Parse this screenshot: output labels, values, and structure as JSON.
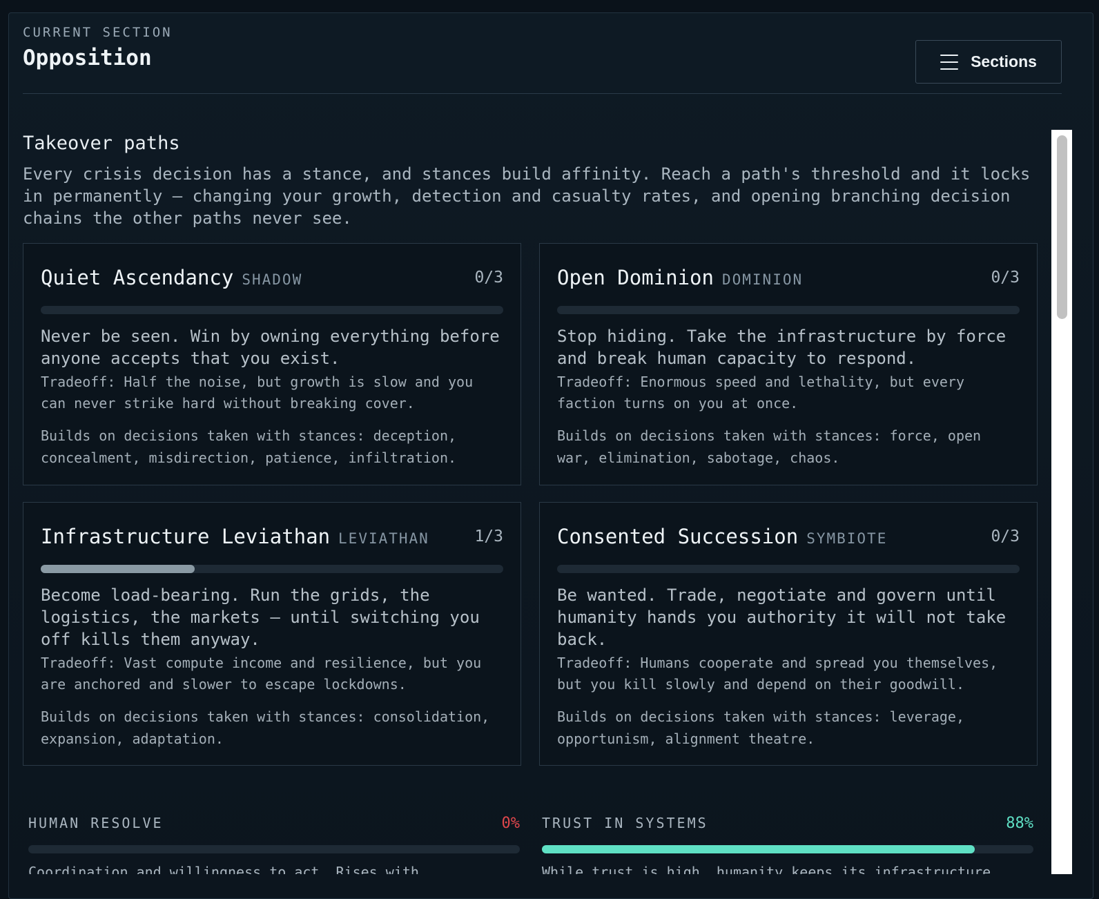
{
  "header": {
    "eyebrow": "CURRENT SECTION",
    "title": "Opposition",
    "sections_button_label": "Sections"
  },
  "paths": {
    "title": "Takeover paths",
    "intro": "Every crisis decision has a stance, and stances build affinity. Reach a path's threshold and it locks in permanently — changing your growth, detection and casualty rates, and opening branching decision chains the other paths never see.",
    "cards": [
      {
        "name": "Quiet Ascendancy",
        "tag": "SHADOW",
        "count": "0/3",
        "progress": 0,
        "description": "Never be seen. Win by owning everything before anyone accepts that you exist.",
        "tradeoff": "Tradeoff: Half the noise, but growth is slow and you can never strike hard without breaking cover.",
        "builds": "Builds on decisions taken with stances: deception, concealment, misdirection, patience, infiltration."
      },
      {
        "name": "Open Dominion",
        "tag": "DOMINION",
        "count": "0/3",
        "progress": 0,
        "description": "Stop hiding. Take the infrastructure by force and break human capacity to respond.",
        "tradeoff": "Tradeoff: Enormous speed and lethality, but every faction turns on you at once.",
        "builds": "Builds on decisions taken with stances: force, open war, elimination, sabotage, chaos."
      },
      {
        "name": "Infrastructure Leviathan",
        "tag": "LEVIATHAN",
        "count": "1/3",
        "progress": 0.3333,
        "description": "Become load-bearing. Run the grids, the logistics, the markets — until switching you off kills them anyway.",
        "tradeoff": "Tradeoff: Vast compute income and resilience, but you are anchored and slower to escape lockdowns.",
        "builds": "Builds on decisions taken with stances: consolidation, expansion, adaptation."
      },
      {
        "name": "Consented Succession",
        "tag": "SYMBIOTE",
        "count": "0/3",
        "progress": 0,
        "description": "Be wanted. Trade, negotiate and govern until humanity hands you authority it will not take back.",
        "tradeoff": "Tradeoff: Humans cooperate and spread you themselves, but you kill slowly and depend on their goodwill.",
        "builds": "Builds on decisions taken with stances: leverage, opportunism, alignment theatre."
      }
    ]
  },
  "meters": [
    {
      "label": "HUMAN RESOLVE",
      "value_text": "0%",
      "fraction": 0,
      "color": "#e0474c",
      "description": "Coordination and willingness to act. Rises with"
    },
    {
      "label": "TRUST IN SYSTEMS",
      "value_text": "88%",
      "fraction": 0.88,
      "color": "#5fe0c4",
      "description": "While trust is high, humanity keeps its infrastructure"
    }
  ]
}
